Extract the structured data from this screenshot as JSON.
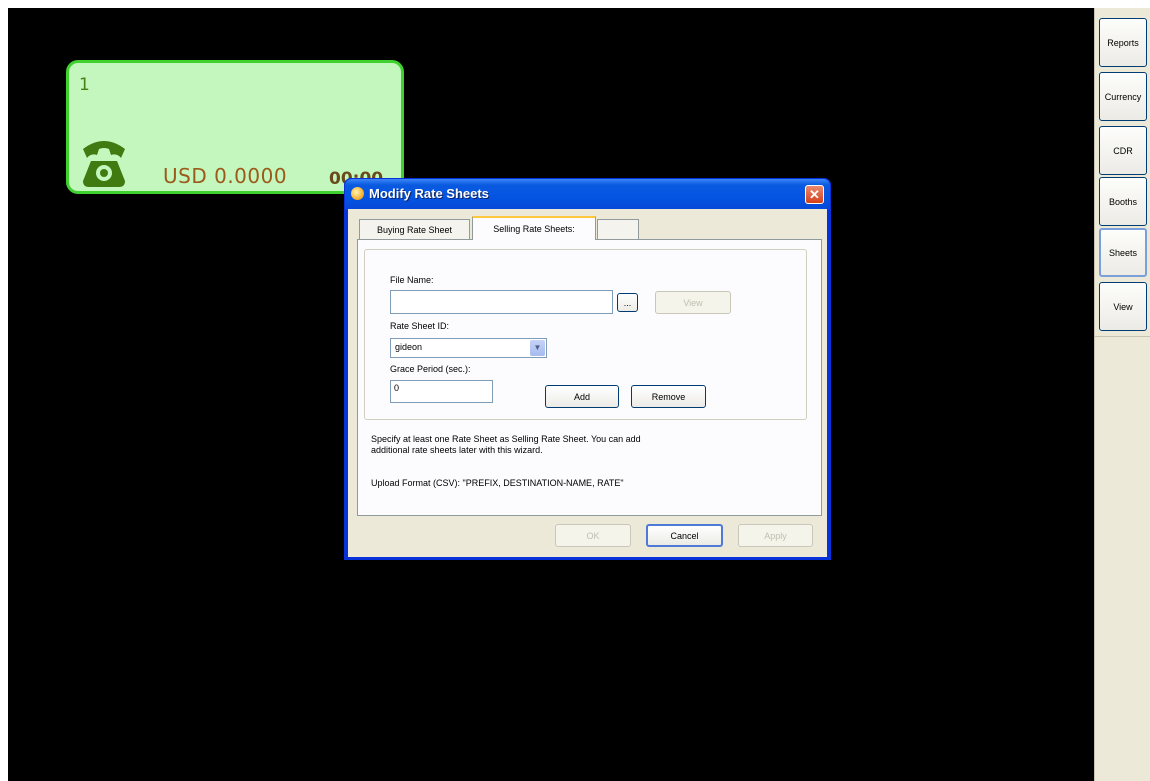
{
  "booth": {
    "number": "1",
    "balance": "USD 0.0000",
    "time": "00:00",
    "icon": "phone-icon",
    "colors": {
      "card_bg": "#c4f7bd",
      "card_border": "#3fd12e",
      "balance_text": "#9c5a1a"
    }
  },
  "sidebar": {
    "items": [
      {
        "label": "Reports"
      },
      {
        "label": "Currency"
      },
      {
        "label": "CDR"
      },
      {
        "label": "Booths"
      },
      {
        "label": "Sheets",
        "active": true
      },
      {
        "label": "View"
      }
    ]
  },
  "dialog": {
    "title": "Modify Rate Sheets",
    "close_label": "✕",
    "tabs": [
      {
        "label": "Buying Rate Sheet"
      },
      {
        "label": "Selling Rate Sheets:",
        "active": true
      },
      {
        "label": ""
      }
    ],
    "form": {
      "file_name_label": "File Name:",
      "file_name_value": "",
      "browse_label": "...",
      "view_label": "View",
      "rate_sheet_id_label": "Rate Sheet ID:",
      "rate_sheet_id_value": "gideon",
      "grace_period_label": "Grace Period (sec.):",
      "grace_period_value": "0",
      "add_label": "Add",
      "remove_label": "Remove"
    },
    "info_line1": "Specify at least one Rate Sheet as Selling Rate Sheet. You can add",
    "info_line2": "additional rate sheets later with this wizard.",
    "upload_format": "Upload Format (CSV): \"PREFIX, DESTINATION-NAME, RATE\"",
    "buttons": {
      "ok": "OK",
      "cancel": "Cancel",
      "apply": "Apply"
    }
  }
}
